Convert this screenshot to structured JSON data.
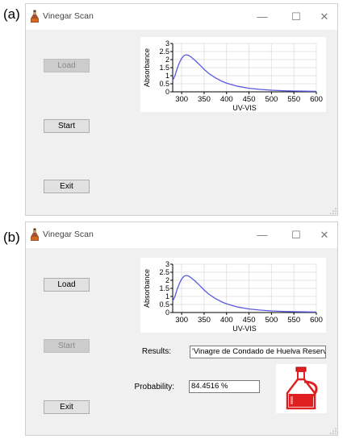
{
  "panels": [
    {
      "label": "(a)",
      "window_title": "Vinegar Scan",
      "controls": {
        "minimize": "—",
        "maximize": "☐",
        "close": "✕"
      },
      "buttons": {
        "load": "Load",
        "start": "Start",
        "exit": "Exit"
      },
      "button_state": {
        "load_enabled": false,
        "start_enabled": true,
        "exit_enabled": true
      }
    },
    {
      "label": "(b)",
      "window_title": "Vinegar Scan",
      "controls": {
        "minimize": "—",
        "maximize": "☐",
        "close": "✕"
      },
      "buttons": {
        "load": "Load",
        "start": "Start",
        "exit": "Exit"
      },
      "button_state": {
        "load_enabled": true,
        "start_enabled": false,
        "exit_enabled": true
      },
      "results_label": "Results:",
      "results_value": "'Vinagre de Condado de Huelva Reserva'",
      "probability_label": "Probability:",
      "probability_value": "84.4516 %",
      "result_icon": "vinegar-bottle-icon",
      "result_icon_color": "#e02020"
    }
  ],
  "chart_data": [
    {
      "type": "line",
      "title": "",
      "xlabel": "UV-VIS",
      "ylabel": "Absorbance",
      "xlim": [
        280,
        600
      ],
      "ylim": [
        0,
        3
      ],
      "xticks": [
        300,
        350,
        400,
        450,
        500,
        550,
        600
      ],
      "yticks": [
        0,
        0.5,
        1,
        1.5,
        2,
        2.5,
        3
      ],
      "ytick_labels": [
        "0",
        "0.5",
        "1",
        "1.5",
        "2",
        "2.5",
        "3"
      ],
      "grid": true,
      "color": "#5a5ae0",
      "series": [
        {
          "x": [
            280,
            285,
            290,
            295,
            300,
            305,
            310,
            315,
            320,
            330,
            340,
            350,
            360,
            375,
            390,
            400,
            425,
            450,
            475,
            500,
            525,
            550,
            575,
            600
          ],
          "y": [
            0.7,
            1.0,
            1.45,
            1.8,
            2.08,
            2.25,
            2.3,
            2.27,
            2.18,
            1.95,
            1.68,
            1.4,
            1.15,
            0.87,
            0.65,
            0.54,
            0.34,
            0.22,
            0.15,
            0.1,
            0.07,
            0.05,
            0.04,
            0.03
          ]
        }
      ]
    },
    {
      "type": "line",
      "title": "",
      "xlabel": "UV-VIS",
      "ylabel": "Absorbance",
      "xlim": [
        280,
        600
      ],
      "ylim": [
        0,
        3
      ],
      "xticks": [
        300,
        350,
        400,
        450,
        500,
        550,
        600
      ],
      "yticks": [
        0,
        0.5,
        1,
        1.5,
        2,
        2.5,
        3
      ],
      "ytick_labels": [
        "0",
        "0.5",
        "1",
        "1.5",
        "2",
        "2.5",
        "3"
      ],
      "grid": true,
      "color": "#5a5ae0",
      "series": [
        {
          "x": [
            280,
            285,
            290,
            295,
            300,
            305,
            310,
            315,
            320,
            330,
            340,
            350,
            360,
            375,
            390,
            400,
            425,
            450,
            475,
            500,
            525,
            550,
            575,
            600
          ],
          "y": [
            0.7,
            1.0,
            1.45,
            1.8,
            2.08,
            2.25,
            2.3,
            2.27,
            2.18,
            1.95,
            1.68,
            1.4,
            1.15,
            0.87,
            0.65,
            0.54,
            0.34,
            0.22,
            0.15,
            0.1,
            0.07,
            0.05,
            0.04,
            0.03
          ]
        }
      ]
    }
  ]
}
